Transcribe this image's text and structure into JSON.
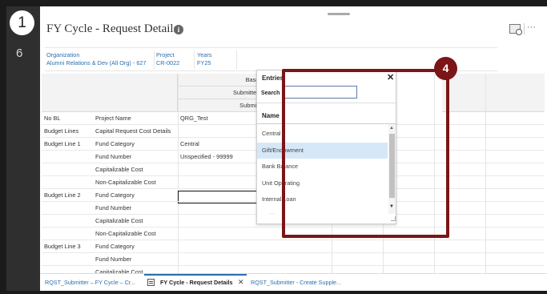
{
  "guide": {
    "current_step": "1",
    "next_step": "6",
    "callout_number": "4"
  },
  "header": {
    "title": "FY Cycle - Request Details"
  },
  "pov": [
    {
      "label": "Organization",
      "value": "Alumni Relations & Dev (All Org) - 627"
    },
    {
      "label": "Project",
      "value": "CR-0022"
    },
    {
      "label": "Years",
      "value": "FY25"
    }
  ],
  "grid": {
    "col_header_1": "Base",
    "col_header_2": "Submitter (FY)",
    "col_header_3": "Submitter",
    "rows": [
      {
        "group": "No BL",
        "label": "Project Name",
        "value": "QRG_Test"
      },
      {
        "group": "Budget Lines",
        "label": "Capital Request Cost Details",
        "value": ""
      },
      {
        "group": "Budget Line 1",
        "label": "Fund Category",
        "value": "Central"
      },
      {
        "group": "",
        "label": "Fund Number",
        "value": "Unspecified - 99999"
      },
      {
        "group": "",
        "label": "Capitalizable Cost",
        "value": ""
      },
      {
        "group": "",
        "label": "Non-Capitalizable Cost",
        "value": ""
      },
      {
        "group": "Budget Line 2",
        "label": "Fund Category",
        "value": ""
      },
      {
        "group": "",
        "label": "Fund Number",
        "value": ""
      },
      {
        "group": "",
        "label": "Capitalizable Cost",
        "value": ""
      },
      {
        "group": "",
        "label": "Non-Capitalizable Cost",
        "value": ""
      },
      {
        "group": "Budget Line 3",
        "label": "Fund Category",
        "value": ""
      },
      {
        "group": "",
        "label": "Fund Number",
        "value": ""
      },
      {
        "group": "",
        "label": "Capitalizable Cost",
        "value": ""
      }
    ]
  },
  "popup": {
    "title": "Entries",
    "search_label": "Search",
    "search_value": "",
    "column_name": "Name",
    "items": [
      "Central",
      "Gift/Endowment",
      "Bank Balance",
      "Unit Operating",
      "Internal Loan",
      "Multi..."
    ],
    "highlighted_index": 1
  },
  "tabs": [
    {
      "label": "RQST_Submitter – FY Cycle – Cr..."
    },
    {
      "label": "FY Cycle - Request Details"
    },
    {
      "label": "RQST_Submitter - Create Supple..."
    }
  ],
  "icons": {
    "info": "info-icon",
    "tab_form": "form-icon",
    "close": "close-icon",
    "more": "ellipsis-icon",
    "zoom": "magnify-grid-icon"
  },
  "colors": {
    "callout": "#7b1518",
    "link": "#2a6fad",
    "highlight": "#d6e7f7"
  }
}
